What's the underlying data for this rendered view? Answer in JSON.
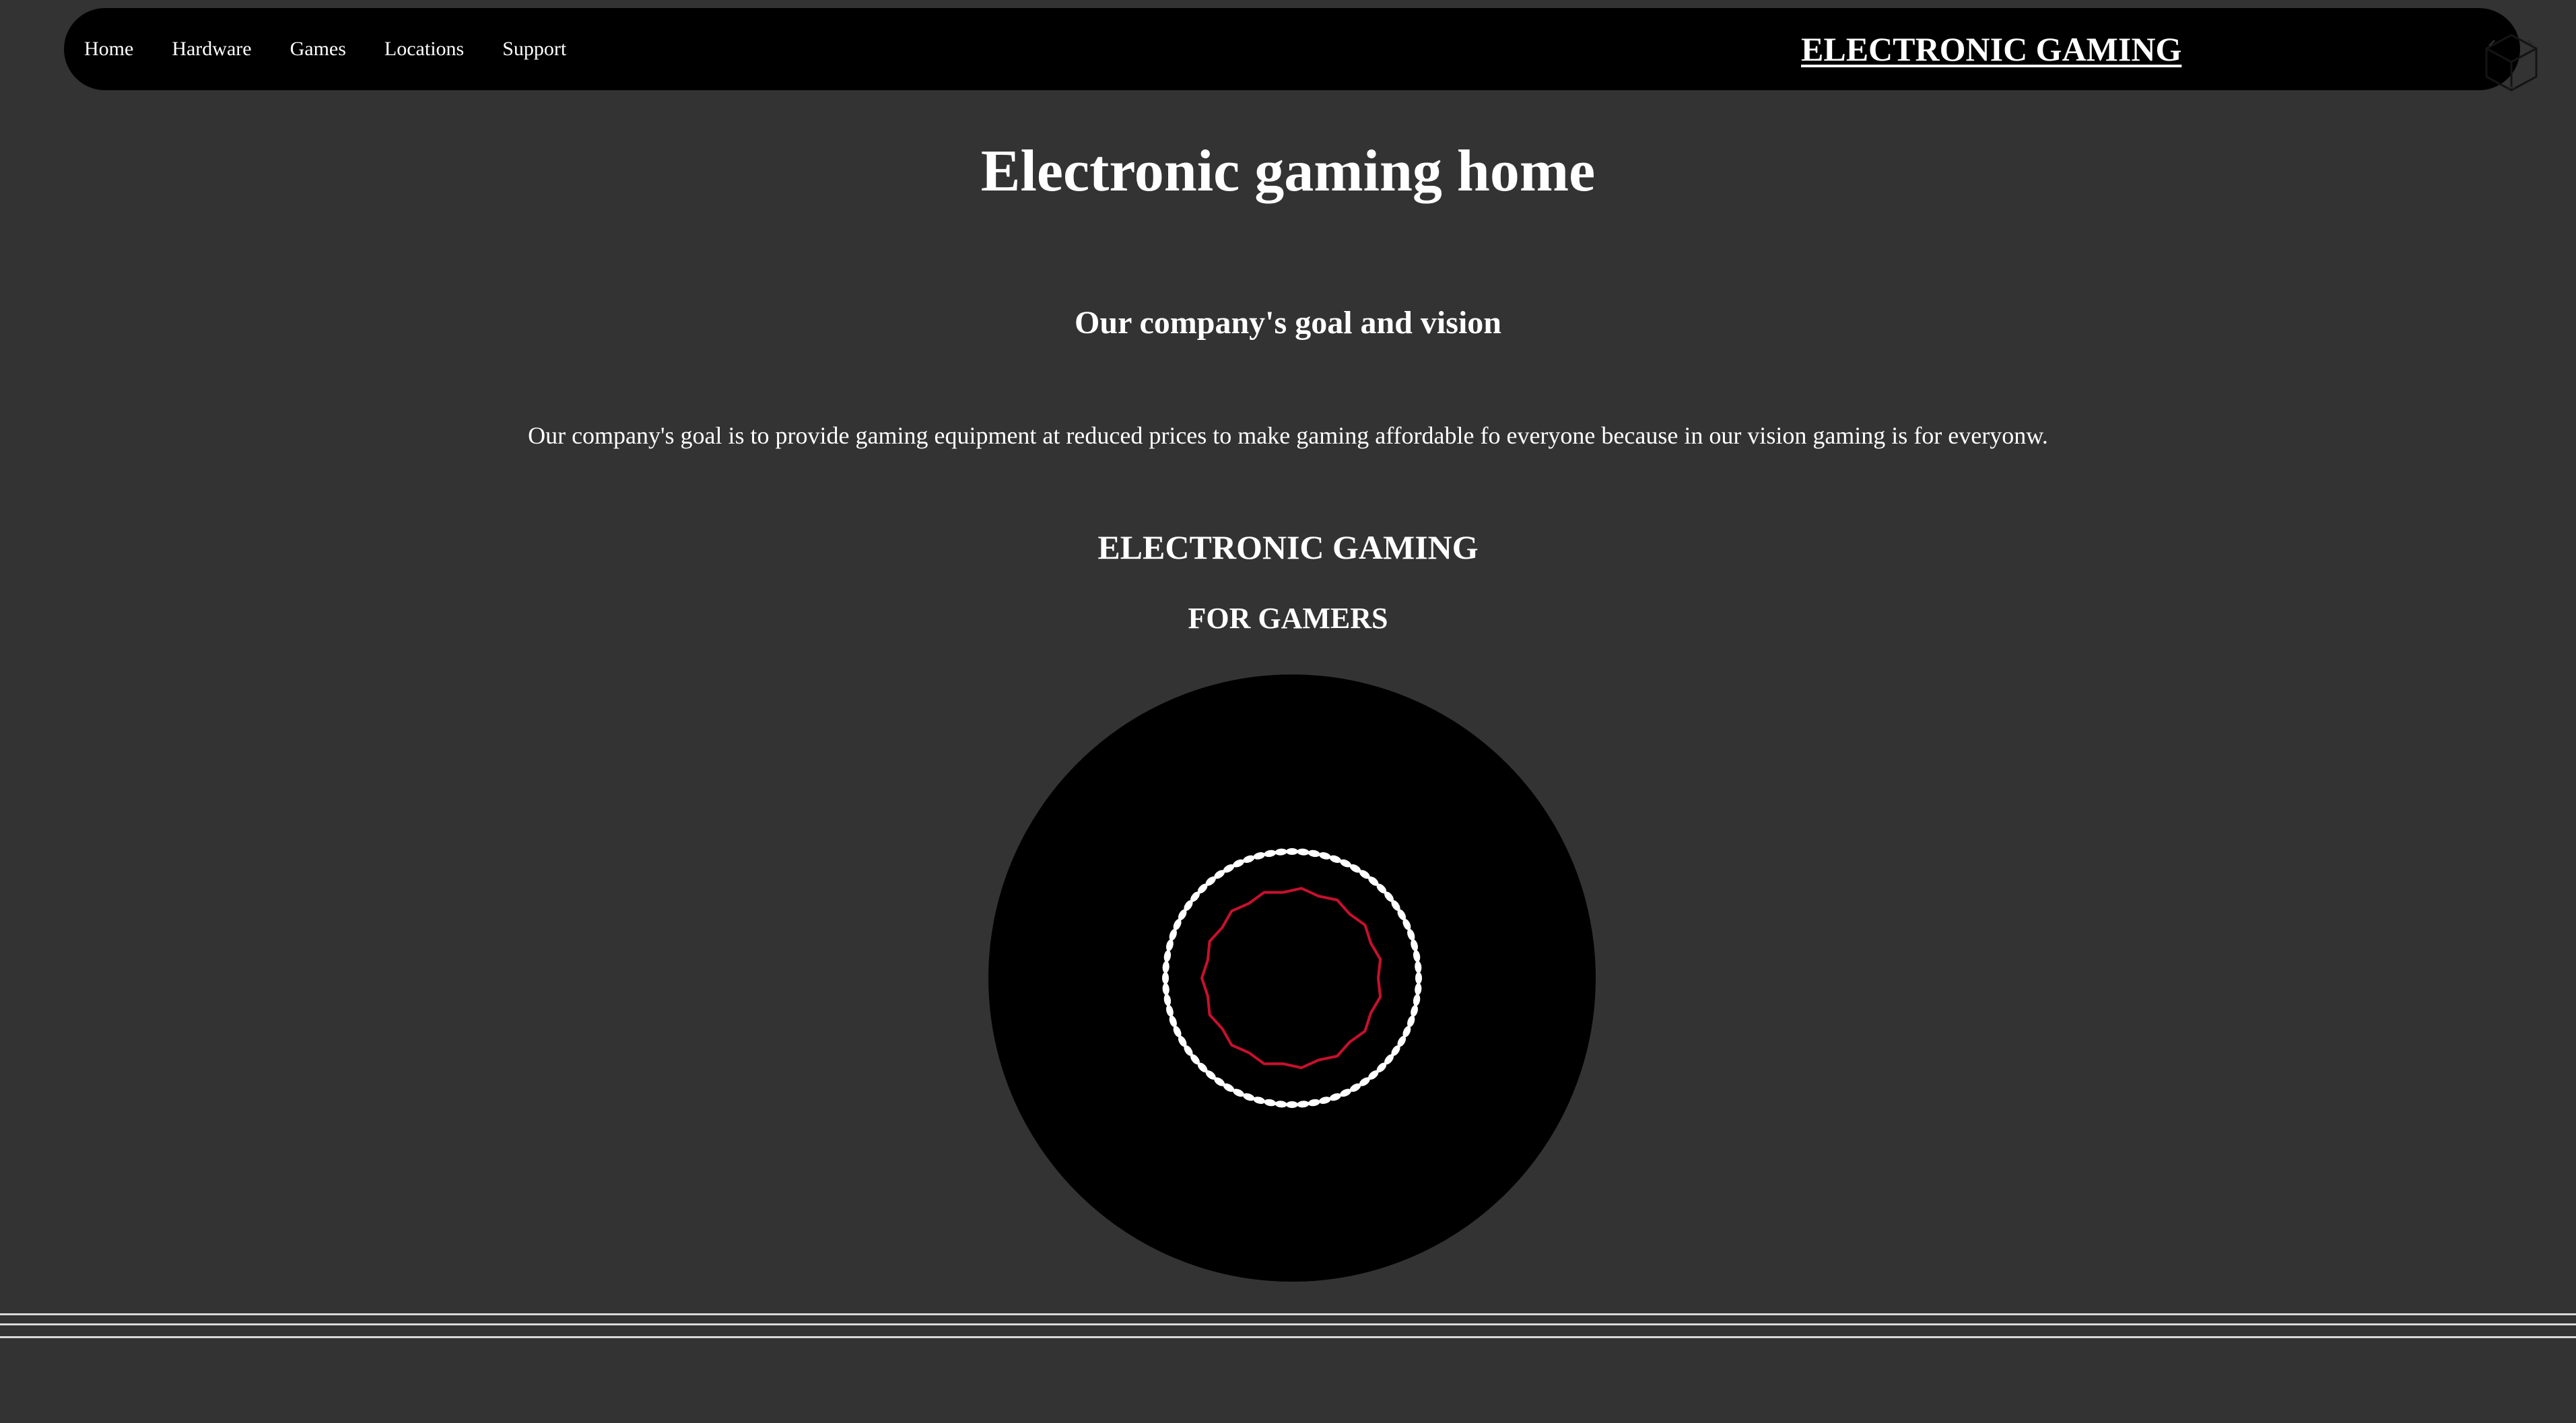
{
  "nav": {
    "links": [
      "Home",
      "Hardware",
      "Games",
      "Locations",
      "Support"
    ],
    "brand": "ELECTRONIC GAMING",
    "logo_icon": "cube-logo-icon"
  },
  "main": {
    "title": "Electronic gaming home",
    "subtitle": "Our company's goal and vision",
    "paragraph": "Our company's goal is to provide gaming equipment at reduced prices to make gaming affordable fo everyone because in our vision gaming is for everyonw.",
    "heading_a": "ELECTRONIC GAMING",
    "heading_b": "FOR GAMERS"
  },
  "colors": {
    "background": "#333333",
    "navbar": "#000000",
    "text": "#ffffff",
    "loader_disc": "#000000",
    "loader_dots": "#ffffff",
    "loader_inner_ring": "#c8102e",
    "footer_lines": "#d9d9d9"
  }
}
